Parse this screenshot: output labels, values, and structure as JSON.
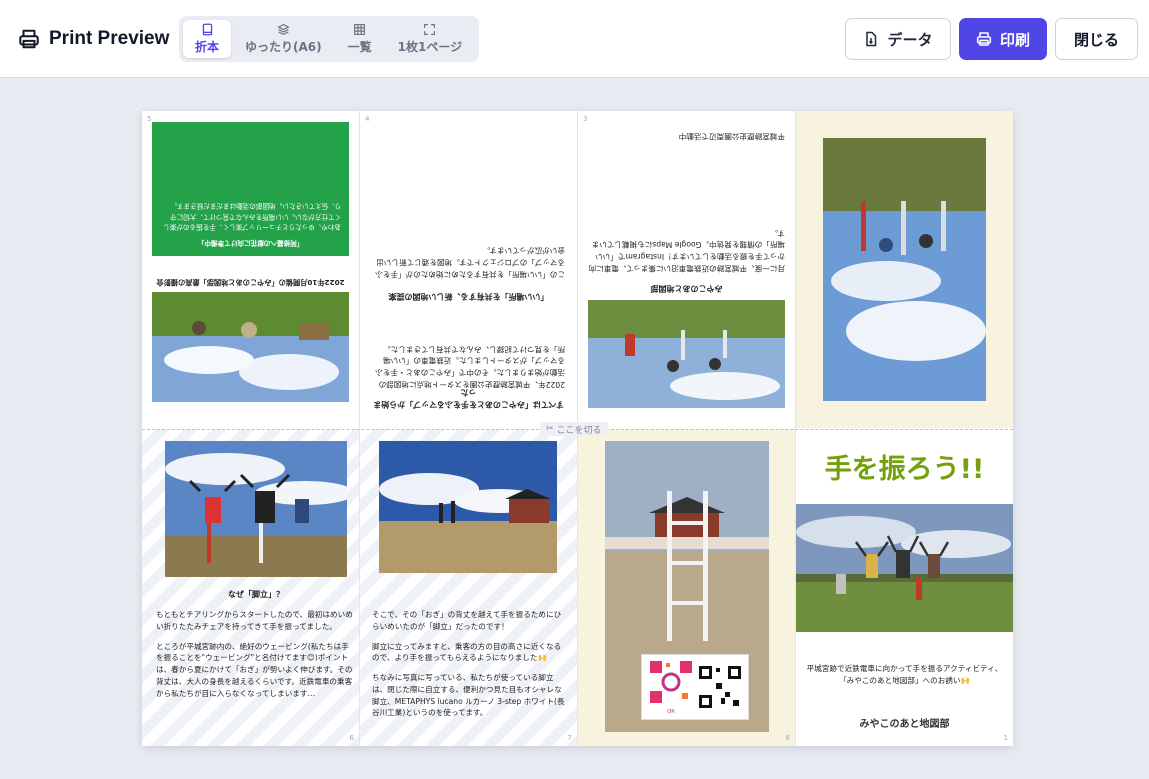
{
  "header": {
    "title": "Print Preview",
    "modes": [
      {
        "label": "折本",
        "icon": "booklet-icon",
        "active": true
      },
      {
        "label": "ゆったり(A6)",
        "icon": "layers-icon",
        "active": false
      },
      {
        "label": "一覧",
        "icon": "grid-icon",
        "active": false
      },
      {
        "label": "1枚1ページ",
        "icon": "expand-icon",
        "active": false
      }
    ],
    "data_button": "データ",
    "print_button": "印刷",
    "close_button": "閉じる"
  },
  "sheet": {
    "cut_label": "ここを切る",
    "page_numbers": {
      "p5": "5",
      "p4": "4",
      "p3": "3",
      "p6": "6",
      "p7": "7",
      "p8": "8",
      "p1": "1"
    },
    "p5": {
      "caption": "2022年10月開催の「みやこのあと地図部」最高の撮影会",
      "green_title": "「阿修羅への献花に向けて準備中」",
      "green_body": "あわや、ゆったりとチューリップ楽しく、手を振るのが楽しくて仕方がない。いい場所をみんなで見つけて、大切に守り、伝えていきたい。地図部の活動はまだまだ続きます。"
    },
    "p4": {
      "heading1": "すべては「みやこのあとを手をふるマップ」から始まった",
      "body1": "2022年、平城宮跡歴史公園をスタート地点に地図部の活動が始まりました。その中で「みやこのあと・手をふるマップ」がスタートしました。近鉄電車の「いい場所」を見つけて記録し、みんなで共有してきました。",
      "heading2": "「いい場所」を共有する、新しい地図の提案",
      "body2": "この「いい場所」を共有するために始めたのが「手をふるマップ」のプロジェクトです。地図を通じて新しい出会いが広がっています。"
    },
    "p3": {
      "heading": "みやこのあと地図部",
      "body": "月に一度、平城宮跡の近鉄電車沿いに集まって、電車に向かって手を振る活動をしています！Instagramで「いい場所」の情報を発信中。Google Mapsにも掲載しています。",
      "footer": "平城宮跡歴史公園周辺で活動中"
    },
    "p6": {
      "heading": "なぜ「脚立」？",
      "para1": "もともとチアリングからスタートしたので、最初はめいめい折りたたみチェアを持ってきて手を振ってました。",
      "para2": "ところが平城宮跡内の、絶好のウェービング(私たちは手を振ることを\"ウェービング\"と名付けてます😊)ポイントは、春から夏にかけて「おぎ」が勢いよく伸びます。その背丈は、大人の身長を越えるくらいです。近鉄電車の乗客から私たちが目に入らなくなってしまいます…"
    },
    "p7": {
      "para1": "そこで、その「おぎ」の背丈を越えて手を振るためにひらいめいたのが「脚立」だったのです！",
      "para2": "脚立に立ってみますと、乗客の方の目の高さに近くなるので、より手を振ってもらえるようになりました🙌",
      "para3": "ちなみに写真に写っている、私たちが使っている脚立は、閉じた際に自立する、便利かつ見た目もオシャレな脚立、METAPHYS lucano ルカーノ 3-step ホワイト(長谷川工業)というのを使ってます。"
    },
    "p1": {
      "title": "手を振ろう!!",
      "description": "平城宮跡で近鉄電車に向かって手を振るアクティビティ、「みやこのあと地図部」へのお誘い🙌",
      "club_name": "みやこのあと地図部"
    }
  }
}
